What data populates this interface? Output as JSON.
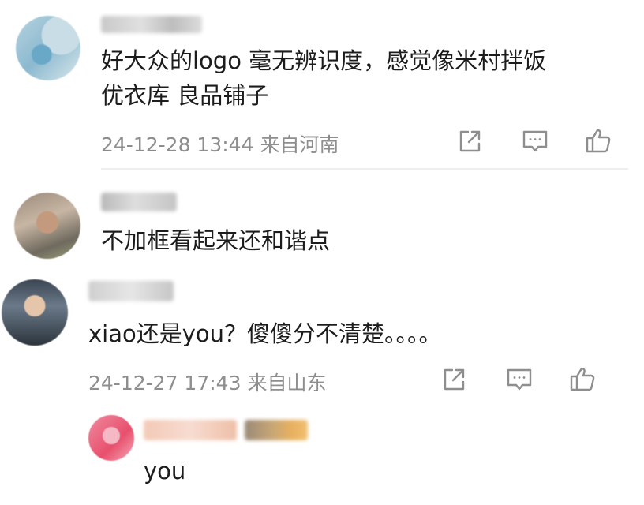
{
  "comments": [
    {
      "text_line1": "好大众的logo 毫无辨识度，感觉像米村拌饭",
      "text_line2": "优衣库 良品铺子",
      "timestamp": "24-12-28 13:44",
      "location": "来自河南"
    },
    {
      "text": "不加框看起来还和谐点"
    },
    {
      "text": "xiao还是you？傻傻分不清楚。。。。",
      "timestamp": "24-12-27 17:43",
      "location": "来自山东",
      "reply": {
        "text": "you"
      }
    }
  ],
  "icons": {
    "share": "share-icon",
    "comment": "comment-icon",
    "like": "thumbs-up-icon"
  },
  "colors": {
    "text": "#1c1c1c",
    "meta": "#8e8e8e",
    "divider": "#eeeeee"
  }
}
